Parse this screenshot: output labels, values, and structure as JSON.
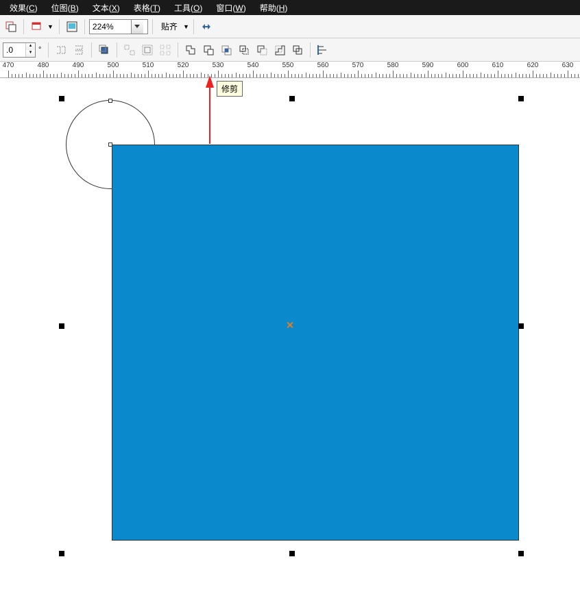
{
  "menu": {
    "items": [
      {
        "label": "效果",
        "key": "C"
      },
      {
        "label": "位图",
        "key": "B"
      },
      {
        "label": "文本",
        "key": "X"
      },
      {
        "label": "表格",
        "key": "T"
      },
      {
        "label": "工具",
        "key": "O"
      },
      {
        "label": "窗口",
        "key": "W"
      },
      {
        "label": "帮助",
        "key": "H"
      }
    ]
  },
  "toolbar1": {
    "zoom_value": "224%",
    "snap_label": "贴齐"
  },
  "toolbar2": {
    "rotation_value": ".0",
    "degree_symbol": "°"
  },
  "tooltip": "修剪",
  "ruler": {
    "labels": [
      "470",
      "480",
      "490",
      "500",
      "510",
      "520",
      "530",
      "540",
      "550",
      "560",
      "570",
      "580",
      "590",
      "600",
      "610",
      "620",
      "630"
    ]
  },
  "canvas": {
    "square_color": "#0a8acc"
  }
}
